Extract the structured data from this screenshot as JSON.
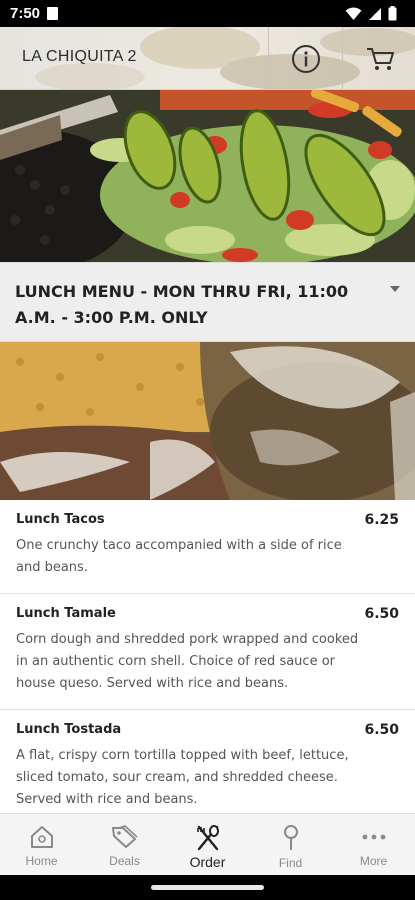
{
  "status_bar": {
    "time": "7:50"
  },
  "header": {
    "title": "LA CHIQUITA 2",
    "info_icon": "info-icon",
    "cart_icon": "cart-icon"
  },
  "category": {
    "selected": "LUNCH MENU - MON THRU FRI, 11:00 A.M. - 3:00 P.M. ONLY"
  },
  "menu_items": [
    {
      "name": "Lunch Tacos",
      "price": "6.25",
      "description": "One crunchy taco accompanied with a side of rice and beans."
    },
    {
      "name": "Lunch Tamale",
      "price": "6.50",
      "description": "Corn dough and shredded pork wrapped and cooked in an authentic corn shell. Choice of red sauce or house queso. Served with rice and beans."
    },
    {
      "name": "Lunch Tostada",
      "price": "6.50",
      "description": "A flat, crispy corn tortilla topped with beef, lettuce, sliced tomato, sour cream, and shredded cheese. Served with rice and beans."
    }
  ],
  "bottom_nav": {
    "items": [
      {
        "label": "Home",
        "icon": "home-icon"
      },
      {
        "label": "Deals",
        "icon": "tag-icon"
      },
      {
        "label": "Order",
        "icon": "utensils-icon",
        "active": true
      },
      {
        "label": "Find",
        "icon": "map-pin-icon"
      },
      {
        "label": "More",
        "icon": "more-dots-icon"
      }
    ]
  },
  "colors": {
    "active_nav": "#222222",
    "inactive_nav": "#8a8a8a",
    "category_bg": "#eeeeee"
  }
}
